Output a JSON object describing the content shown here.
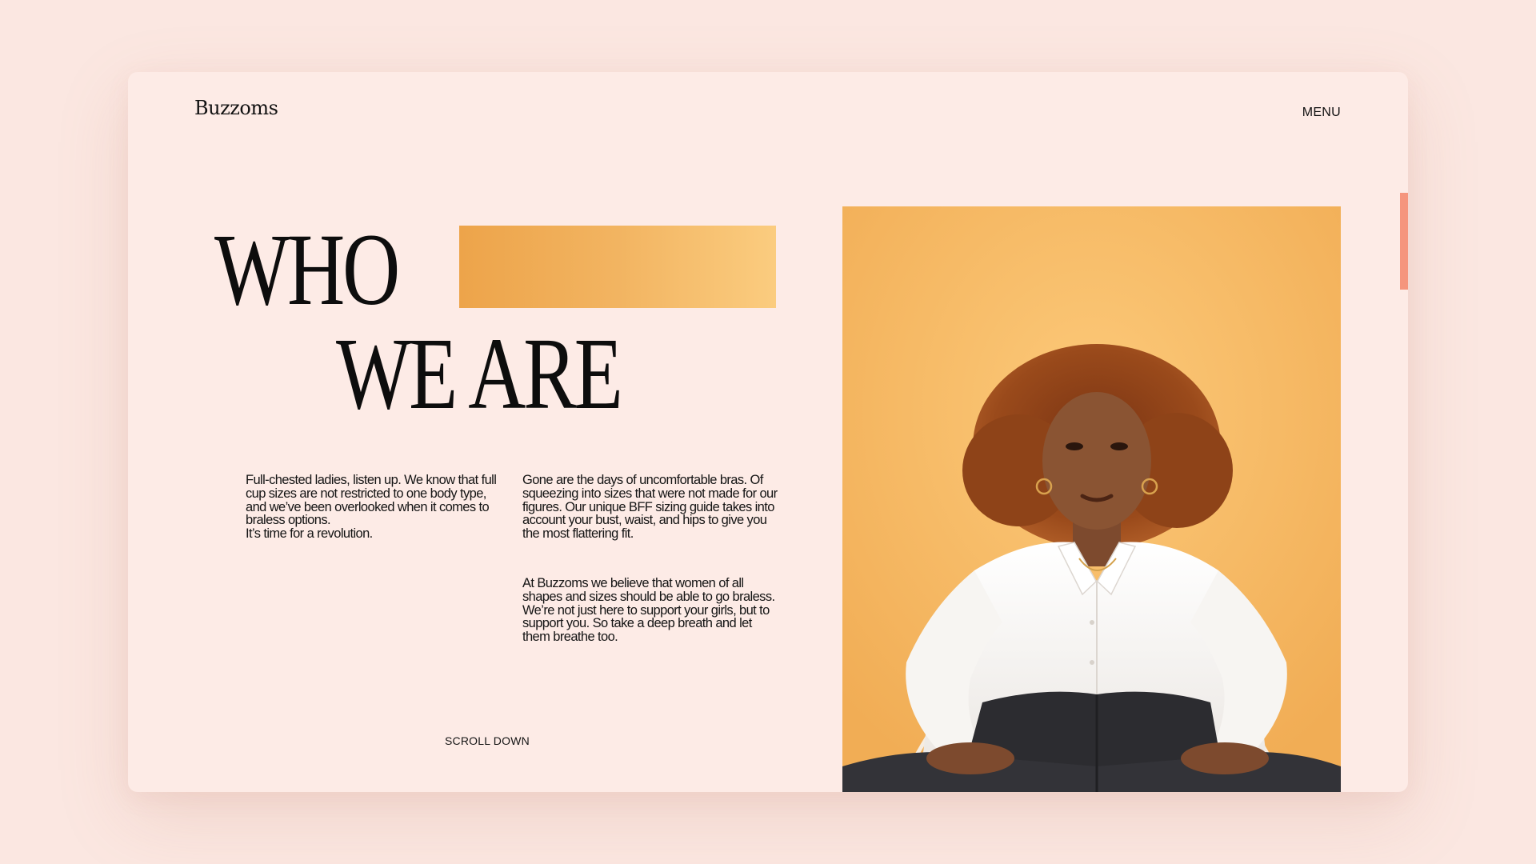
{
  "brand": {
    "logo": "Buzzoms"
  },
  "nav": {
    "menu_label": "MENU"
  },
  "hero": {
    "headline_line1": "WHO",
    "headline_line2": "WE ARE",
    "scroll_label": "SCROLL DOWN",
    "paragraph_left": "Full-chested ladies, listen up. We know that full cup sizes are not restricted to one body type, and we’ve been overlooked when it comes to braless options.",
    "paragraph_left_tagline": "It’s time for a revolution.",
    "paragraph_right_1": "Gone are the days of uncomfortable bras. Of squeezing into sizes that were not made for our figures. Our unique BFF sizing guide takes into account your bust, waist, and hips to give you the most flattering fit.",
    "paragraph_right_2": "At Buzzoms we believe that women of all shapes and sizes should be able to go braless. We’re not just here to support your girls, but to support you. So take a deep breath and let them breathe too."
  },
  "colors": {
    "background": "#fbe7e1",
    "card": "#fdebe6",
    "accent_bar_start": "#eda44a",
    "accent_bar_end": "#fbcc7f",
    "scroll_indicator": "#f5957d",
    "photo_background": "#f7bd68",
    "text": "#141414"
  },
  "photo": {
    "icon": "portrait-photo"
  }
}
